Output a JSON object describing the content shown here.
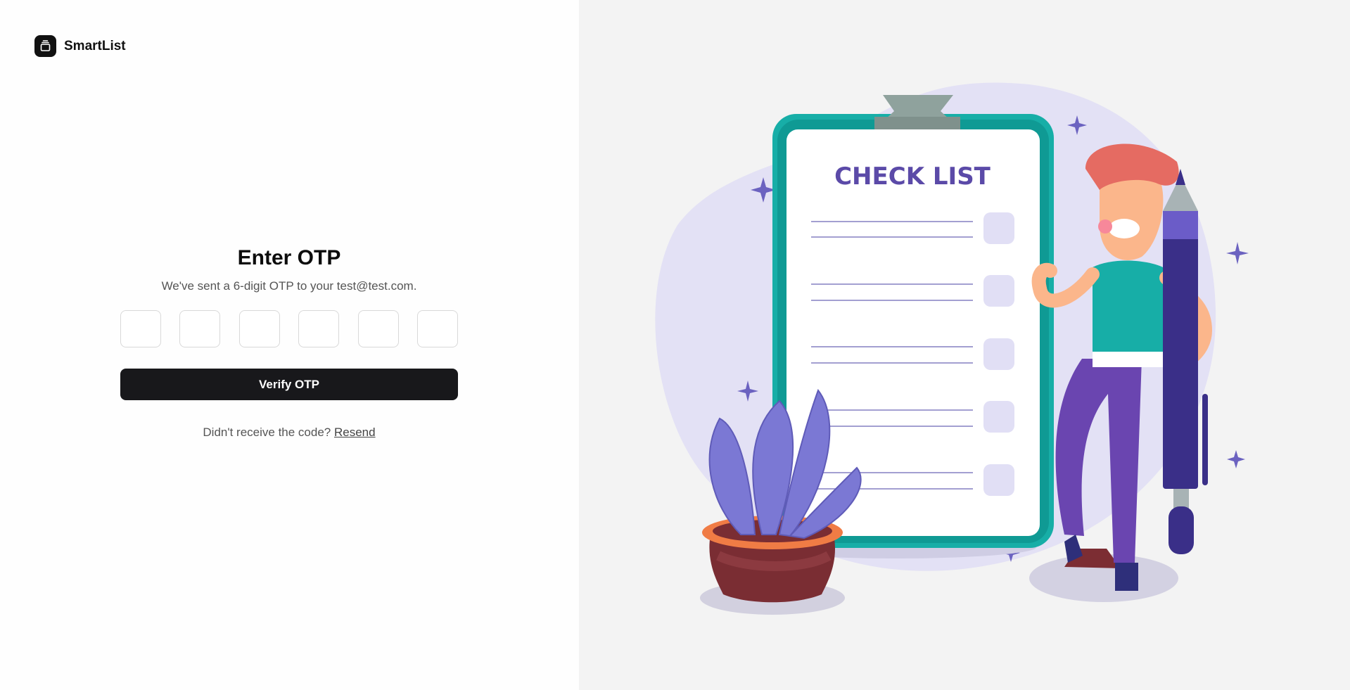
{
  "brand": {
    "name": "SmartList",
    "logo_icon": "layers-icon"
  },
  "form": {
    "title": "Enter OTP",
    "subtitle": "We've sent a 6-digit OTP to your test@test.com.",
    "otp_digits": [
      "",
      "",
      "",
      "",
      "",
      ""
    ],
    "verify_label": "Verify OTP",
    "resend_prompt": "Didn't receive the code?",
    "resend_label": "Resend"
  },
  "illustration": {
    "heading": "CHECK LIST",
    "items": 5
  },
  "colors": {
    "button_bg": "#18181b",
    "panel_bg": "#f3f3f3",
    "accent_teal": "#1fb5ad",
    "accent_purple": "#5b4aa8"
  }
}
